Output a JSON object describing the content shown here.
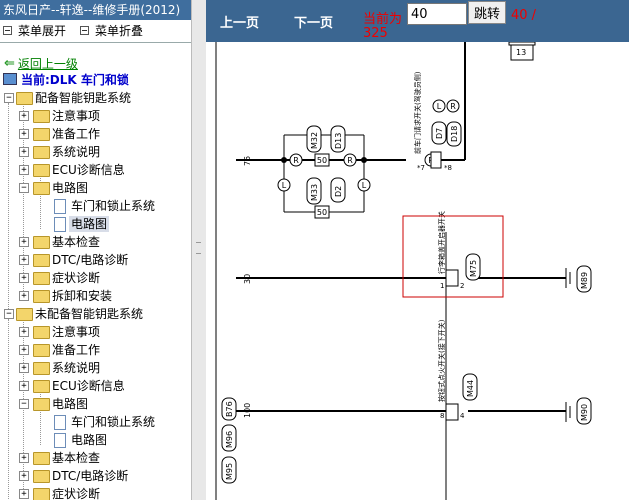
{
  "window_title": "东风日产--轩逸--维修手册(2012)",
  "menubar": {
    "expand_label": "菜单展开",
    "collapse_label": "菜单折叠"
  },
  "back_label": "返回上一级",
  "current_label": "当前:DLK 车门和锁",
  "tree": {
    "g1": {
      "label": "配备智能钥匙系统",
      "items": [
        "注意事项",
        "准备工作",
        "系统说明",
        "ECU诊断信息",
        "电路图",
        "车门和锁止系统",
        "电路图",
        "基本检查",
        "DTC/电路诊断",
        "症状诊断",
        "拆卸和安装"
      ]
    },
    "g2": {
      "label": "未配备智能钥匙系统",
      "items": [
        "注意事项",
        "准备工作",
        "系统说明",
        "ECU诊断信息",
        "电路图",
        "车门和锁止系统",
        "电路图",
        "基本检查",
        "DTC/电路诊断",
        "症状诊断"
      ]
    }
  },
  "toolbar": {
    "prev_label": "上一页",
    "next_label": "下一页",
    "current_page_label": "当前为",
    "page_value": "40",
    "go_label": "跳转",
    "total_line1": "40 /",
    "total_line2": "325"
  },
  "diagram": {
    "row_numbers": [
      "75",
      "30",
      "100"
    ],
    "connectors": [
      "M32",
      "D13",
      "M33",
      "D2",
      "D7",
      "D18",
      "M75",
      "M89",
      "M44",
      "M90",
      "B76",
      "M96",
      "M95",
      "13"
    ],
    "switch_front_label": "前车门请求开关(驾驶员侧)",
    "switch_trunk_label": "行李箱盖开启器开关",
    "switch_ignition_label": "按钮式点火开关(接下开关)",
    "wire_labels": [
      "R",
      "L",
      "50",
      "R",
      "L",
      "50",
      "*7",
      "*8",
      "1",
      "2",
      "8",
      "4",
      "L",
      "R"
    ],
    "accent_color": "#cc0000"
  }
}
